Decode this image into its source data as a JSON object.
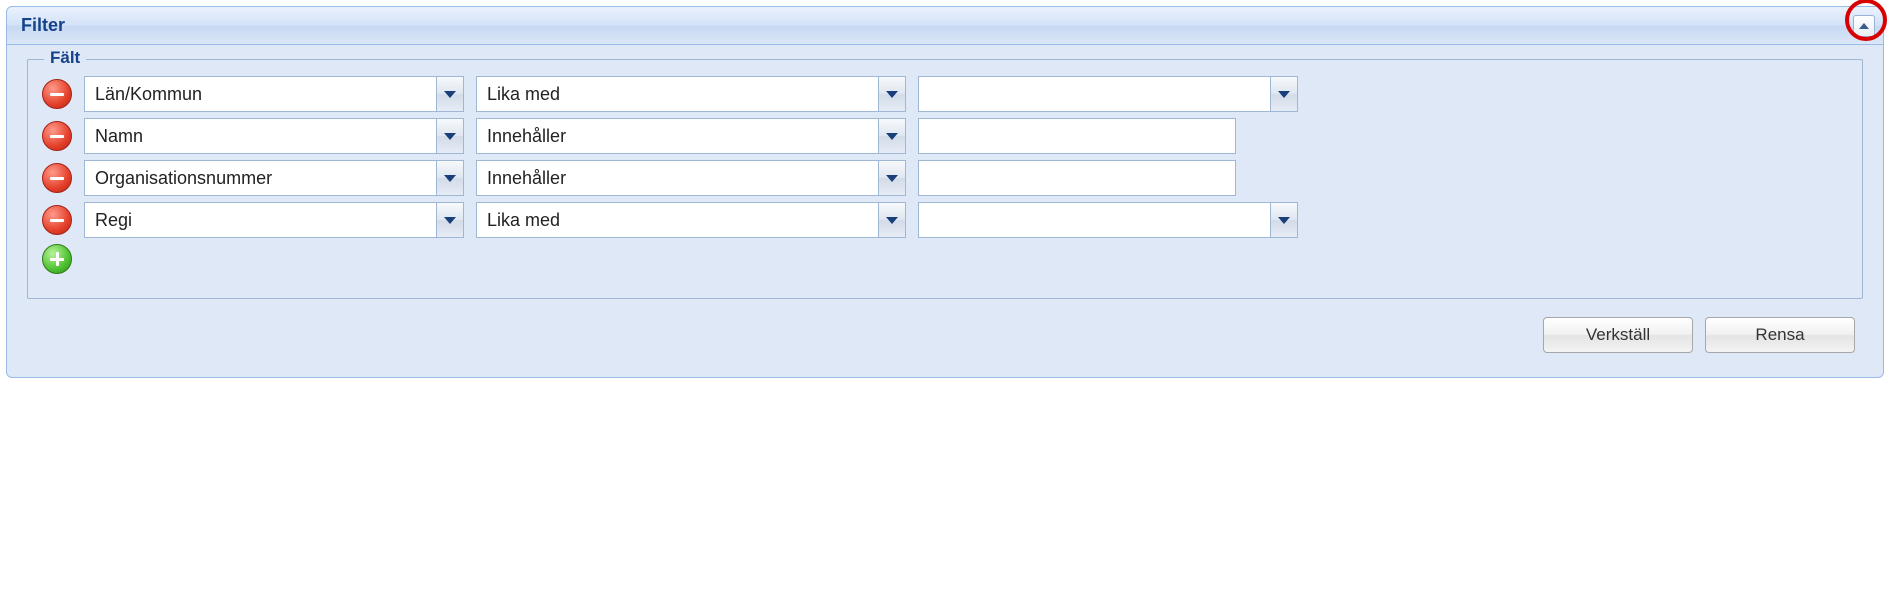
{
  "panel": {
    "title": "Filter"
  },
  "fieldset": {
    "legend": "Fält"
  },
  "rows": [
    {
      "field": "Län/Kommun",
      "operator": "Lika med",
      "value": "",
      "valueType": "combo"
    },
    {
      "field": "Namn",
      "operator": "Innehåller",
      "value": "",
      "valueType": "text"
    },
    {
      "field": "Organisationsnummer",
      "operator": "Innehåller",
      "value": "",
      "valueType": "text"
    },
    {
      "field": "Regi",
      "operator": "Lika med",
      "value": "",
      "valueType": "combo"
    }
  ],
  "buttons": {
    "apply": "Verkställ",
    "clear": "Rensa"
  }
}
